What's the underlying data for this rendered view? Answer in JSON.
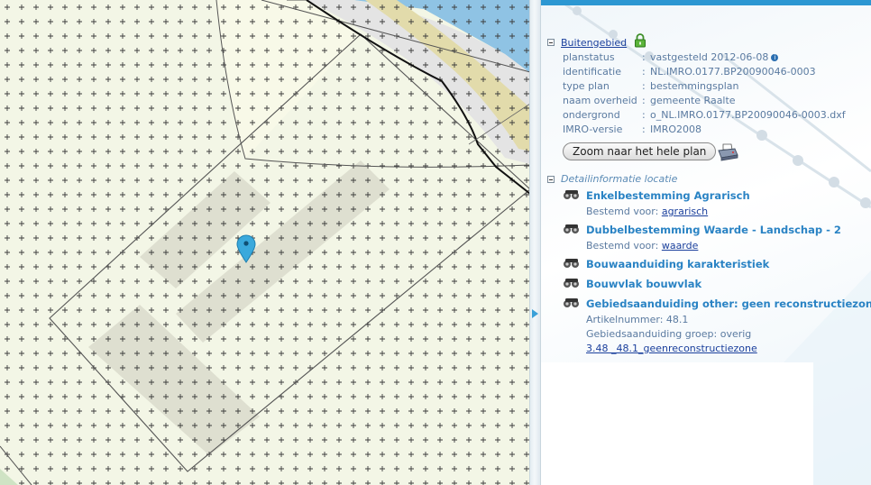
{
  "colors": {
    "map_background": "#f3f6e6",
    "building_area": "#dedfd0",
    "boundary": "#555555",
    "river": "#8fc3e4",
    "river_bank": "#e2dbab",
    "marker": "#3aa9dc",
    "panel_header": "#2c97d2",
    "title_blue": "#2a83c4",
    "link_blue": "#1a3f9c",
    "value_text": "#5a7aa0"
  },
  "map": {
    "marker_icon": "map-pin-icon"
  },
  "plan": {
    "name": "Buitengebied",
    "lock_icon": "lock-icon",
    "fields": [
      {
        "key": "planstatus",
        "value": "vastgesteld 2012-06-08",
        "has_info": true
      },
      {
        "key": "identificatie",
        "value": "NL.IMRO.0177.BP20090046-0003",
        "has_info": false
      },
      {
        "key": "type plan",
        "value": "bestemmingsplan",
        "has_info": false
      },
      {
        "key": "naam overheid",
        "value": "gemeente Raalte",
        "has_info": false
      },
      {
        "key": "ondergrond",
        "value": "o_NL.IMRO.0177.BP20090046-0003.dxf",
        "has_info": false
      },
      {
        "key": "IMRO-versie",
        "value": "IMRO2008",
        "has_info": false
      }
    ],
    "separator": ":",
    "zoom_button": "Zoom naar het hele plan",
    "print_icon": "print-icon"
  },
  "detail": {
    "title": "Detailinformatie locatie",
    "items": [
      {
        "title": "Enkelbestemming Agrarisch",
        "sub_label": "Bestemd voor:",
        "sub_link": "agrarisch"
      },
      {
        "title": "Dubbelbestemming Waarde - Landschap - 2",
        "sub_label": "Bestemd voor:",
        "sub_link": "waarde"
      },
      {
        "title": "Bouwaanduiding karakteristiek"
      },
      {
        "title": "Bouwvlak bouwvlak"
      },
      {
        "title": "Gebiedsaanduiding other: geen reconstructiezone",
        "line1": "Artikelnummer: 48.1",
        "line2": "Gebiedsaanduiding groep: overig",
        "link": "3.48 _48.1_geenreconstructiezone"
      }
    ]
  }
}
